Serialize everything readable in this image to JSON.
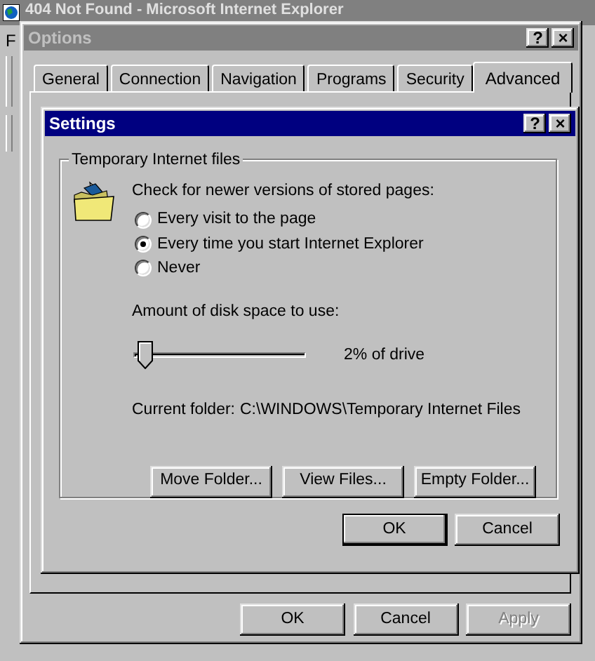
{
  "background_window": {
    "title": "404 Not Found - Microsoft Internet Explorer",
    "menu": [
      "F"
    ]
  },
  "options": {
    "title": "Options",
    "title_buttons": [
      "?",
      "×"
    ],
    "tabs": [
      {
        "label": "General",
        "selected": false
      },
      {
        "label": "Connection",
        "selected": false
      },
      {
        "label": "Navigation",
        "selected": false
      },
      {
        "label": "Programs",
        "selected": false
      },
      {
        "label": "Security",
        "selected": false
      },
      {
        "label": "Advanced",
        "selected": true
      }
    ],
    "buttons": [
      {
        "label": "OK",
        "disabled": false
      },
      {
        "label": "Cancel",
        "disabled": false
      },
      {
        "label": "Apply",
        "disabled": true
      }
    ]
  },
  "settings": {
    "title": "Settings",
    "active": true,
    "title_buttons": [
      "?",
      "×"
    ],
    "group": {
      "label": "Temporary Internet files",
      "prompt": "Check for newer versions of stored pages:",
      "options": [
        {
          "label": "Every visit to the page",
          "selected": false
        },
        {
          "label": "Every time you start Internet Explorer",
          "selected": true
        },
        {
          "label": "Never",
          "selected": false
        }
      ],
      "disk_label": "Amount of disk space to use:",
      "disk_slider": {
        "level": 0.02
      },
      "disk_reading": "2% of drive",
      "folder_label": "Current folder:",
      "folder_path": "C:\\WINDOWS\\Temporary Internet Files",
      "buttons": [
        "Move Folder...",
        "View Files...",
        "Empty Folder..."
      ]
    },
    "buttons": [
      {
        "label": "OK",
        "default": true
      },
      {
        "label": "Cancel",
        "default": false
      }
    ]
  }
}
